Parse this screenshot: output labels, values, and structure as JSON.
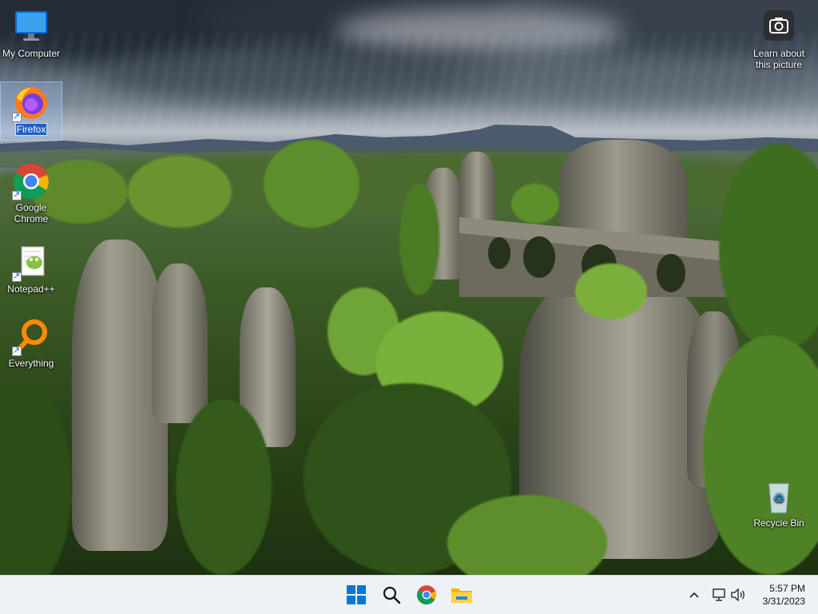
{
  "desktop": {
    "icons": [
      {
        "label": "My Computer"
      },
      {
        "label": "Firefox"
      },
      {
        "label": "Google Chrome"
      },
      {
        "label": "Notepad++"
      },
      {
        "label": "Everything"
      },
      {
        "label": "Recycle Bin"
      }
    ],
    "spotlight": {
      "label": "Learn about this picture"
    }
  },
  "taskbar": {
    "pinned": [
      "start-icon",
      "search-icon",
      "chrome-icon",
      "file-explorer-icon"
    ],
    "tray": {
      "icons": [
        "chevron-up-icon",
        "network-icon",
        "volume-icon"
      ]
    },
    "clock": {
      "time": "5:57 PM",
      "date": "3/31/2023"
    }
  },
  "colors": {
    "taskbar_bg": "#eef1f5",
    "selection": "#1f5fbf",
    "accent": "#0078d4"
  }
}
